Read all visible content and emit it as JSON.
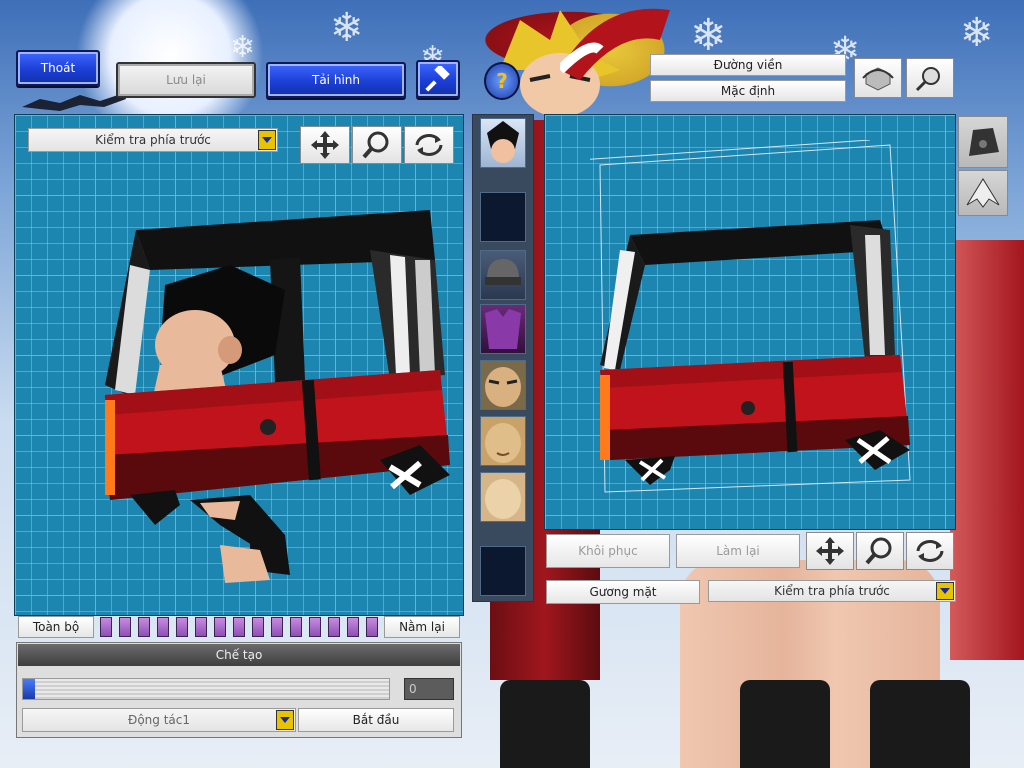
{
  "top_bar": {
    "exit_label": "Thoát",
    "save_label": "Lưu lại",
    "load_label": "Tải hình"
  },
  "right_top": {
    "outline_label": "Đường viền",
    "default_label": "Mặc định"
  },
  "left_panel": {
    "view_select": "Kiểm tra phía trước",
    "all_label": "Toàn bộ",
    "lie_label": "Nằm lại",
    "create_header": "Chế tạo",
    "progress_value": "0",
    "action_select": "Động tác1",
    "start_label": "Bắt đầu"
  },
  "right_panel": {
    "restore_label": "Khôi phục",
    "redo_label": "Làm lại",
    "face_label": "Gương mặt",
    "view_select": "Kiểm tra phía trước"
  },
  "slider_segments": 14,
  "icons": [
    "move-icon",
    "zoom-icon",
    "rotate-icon",
    "hammer-icon",
    "help-icon",
    "refresh-icon",
    "search-icon"
  ],
  "colors": {
    "grid_bg": "#1c86b0",
    "blue_button": "#1c3fd6",
    "bus_red": "#c0131b",
    "dropdown_yellow": "#e8c400"
  }
}
